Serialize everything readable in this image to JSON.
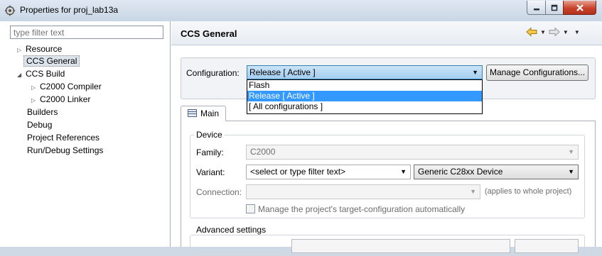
{
  "window": {
    "title": "Properties for proj_lab13a"
  },
  "filter": {
    "placeholder": "type filter text"
  },
  "tree": {
    "items": [
      {
        "label": "Resource"
      },
      {
        "label": "CCS General"
      },
      {
        "label": "CCS Build"
      },
      {
        "label": "C2000 Compiler"
      },
      {
        "label": "C2000 Linker"
      },
      {
        "label": "Builders"
      },
      {
        "label": "Debug"
      },
      {
        "label": "Project References"
      },
      {
        "label": "Run/Debug Settings"
      }
    ]
  },
  "page": {
    "title": "CCS General",
    "nav_icons": [
      "back-arrow-icon",
      "forward-arrow-icon",
      "view-menu-icon"
    ]
  },
  "configuration": {
    "label": "Configuration:",
    "selected": "Release  [ Active ]",
    "manage_button": "Manage Configurations...",
    "options": [
      "Flash",
      "Release  [ Active ]",
      "[ All configurations ]"
    ]
  },
  "tab": {
    "label": "Main"
  },
  "device": {
    "legend": "Device",
    "family_label": "Family:",
    "family_value": "C2000",
    "variant_label": "Variant:",
    "variant_filter": "<select or type filter text>",
    "variant_value": "Generic C28xx Device",
    "connection_label": "Connection:",
    "connection_value": "",
    "connection_note": "(applies to whole project)",
    "manage_checkbox_label": "Manage the project's target-configuration automatically"
  },
  "advanced": {
    "legend": "Advanced settings"
  },
  "colors": {
    "selection_blue": "#3399ff",
    "combo_highlight": "#a3cdef",
    "close_red": "#c8432b"
  }
}
